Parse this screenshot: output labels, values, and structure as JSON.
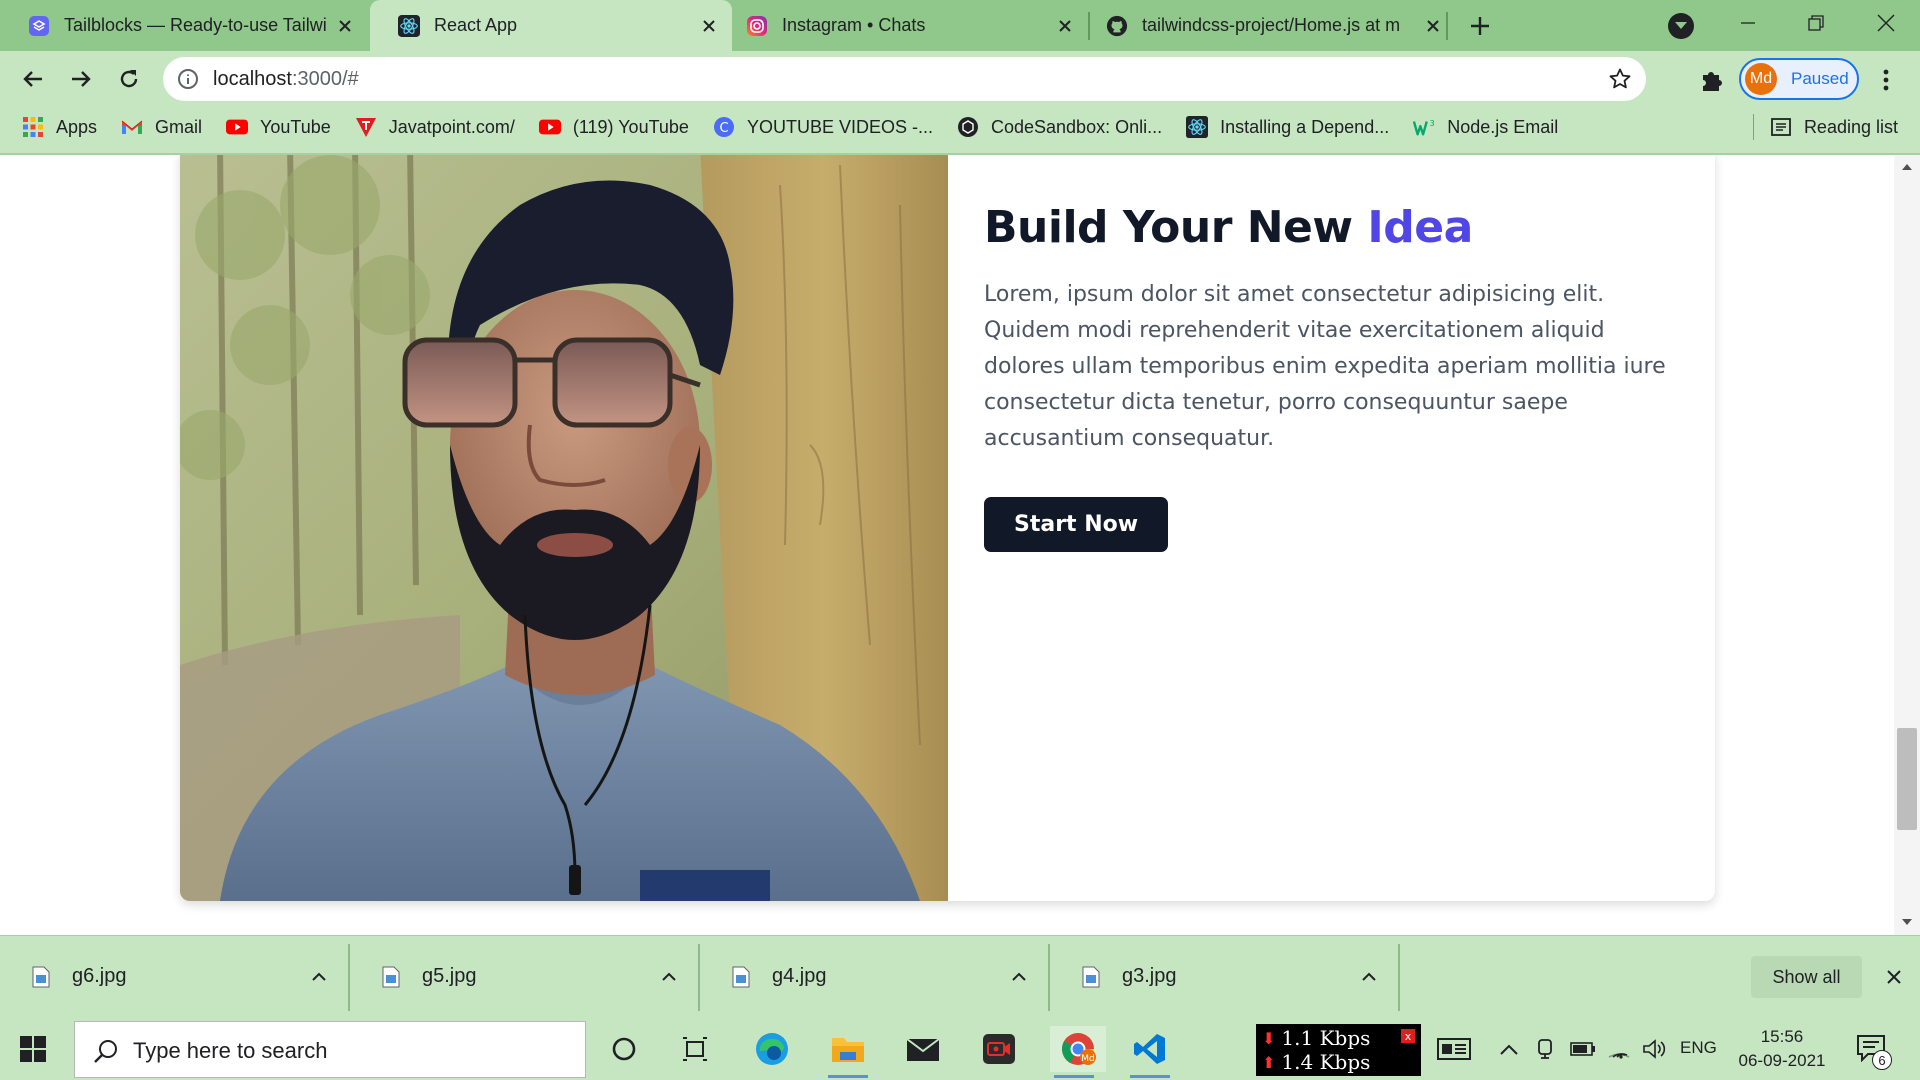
{
  "browser": {
    "tabs": [
      {
        "title": "Tailblocks — Ready-to-use Tailwi",
        "active": false
      },
      {
        "title": "React App",
        "active": true
      },
      {
        "title": "Instagram • Chats",
        "active": false
      },
      {
        "title": "tailwindcss-project/Home.js at m",
        "active": false
      }
    ],
    "url_host": "localhost",
    "url_rest": ":3000/#",
    "profile_initials": "Md",
    "profile_label": "Paused",
    "bookmarks": [
      {
        "label": "Apps",
        "icon": "apps-grid-icon"
      },
      {
        "label": "Gmail",
        "icon": "gmail-icon"
      },
      {
        "label": "YouTube",
        "icon": "youtube-icon"
      },
      {
        "label": "Javatpoint.com/",
        "icon": "javatpoint-icon"
      },
      {
        "label": "(119) YouTube",
        "icon": "youtube-icon"
      },
      {
        "label": "YOUTUBE VIDEOS -...",
        "icon": "c-circle-icon"
      },
      {
        "label": "CodeSandbox: Onli...",
        "icon": "codesandbox-icon"
      },
      {
        "label": "Installing a Depend...",
        "icon": "react-icon"
      },
      {
        "label": "Node.js Email",
        "icon": "w3schools-icon"
      }
    ],
    "reading_list": "Reading list"
  },
  "page": {
    "headline_main": "Build Your New ",
    "headline_accent": "Idea",
    "paragraph": "Lorem, ipsum dolor sit amet consectetur adipisicing elit. Quidem modi reprehenderit vitae exercitationem aliquid dolores ullam temporibus enim expedita aperiam mollitia iure consectetur dicta tenetur, porro consequuntur saepe accusantium consequatur.",
    "cta_label": "Start Now",
    "colors": {
      "accent": "#4f46e5",
      "heading": "#111827",
      "button": "#111827",
      "text": "#4b5563"
    }
  },
  "downloads": {
    "files": [
      "g6.jpg",
      "g5.jpg",
      "g4.jpg",
      "g3.jpg"
    ],
    "show_all": "Show all"
  },
  "taskbar": {
    "search_placeholder": "Type here to search",
    "net_down": "1.1 Kbps",
    "net_up": "1.4 Kbps",
    "net_close": "x",
    "language": "ENG",
    "time": "15:56",
    "date": "06-09-2021",
    "notification_count": "6"
  }
}
